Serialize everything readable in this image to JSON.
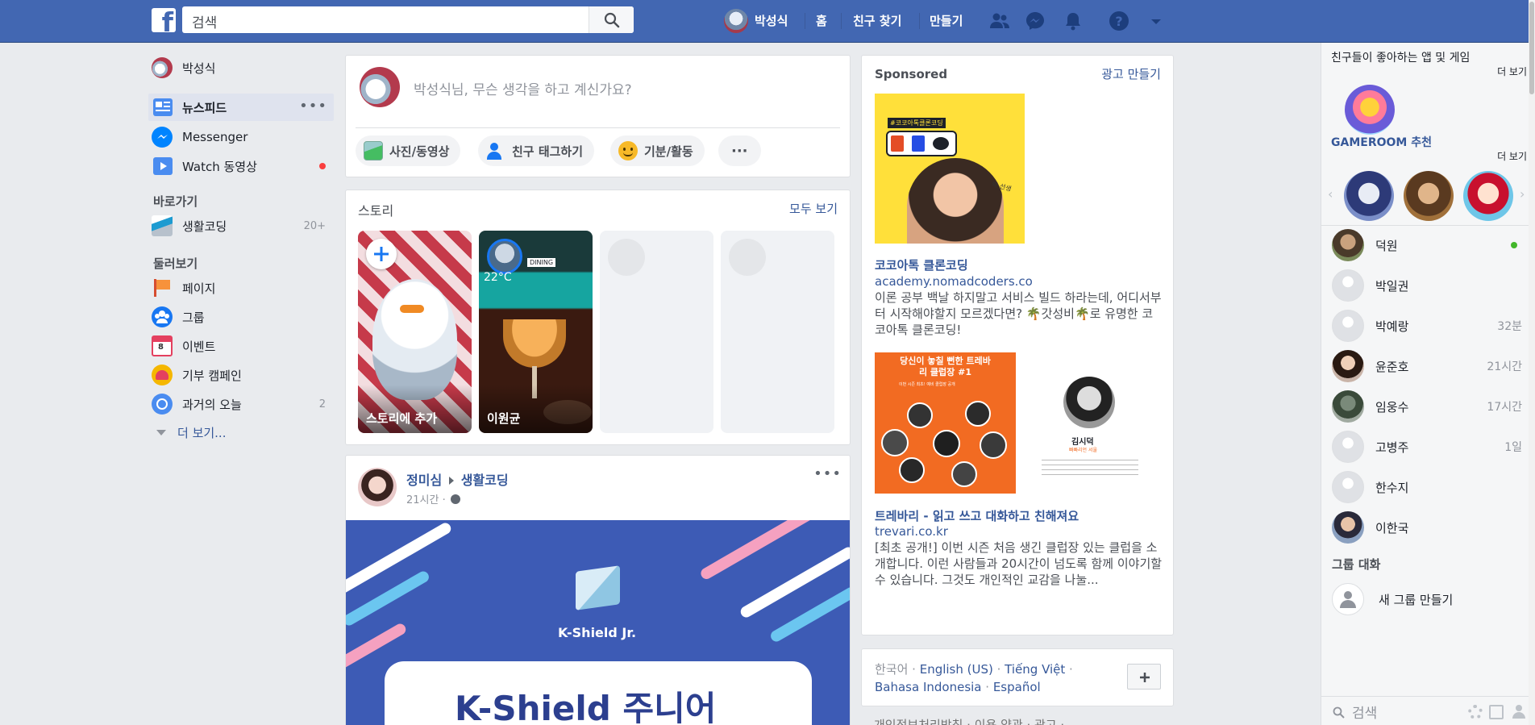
{
  "topbar": {
    "search_placeholder": "검색",
    "user_name": "박성식",
    "home": "홈",
    "find_friends": "친구 찾기",
    "create": "만들기"
  },
  "left": {
    "profile_name": "박성식",
    "items": [
      {
        "label": "뉴스피드",
        "icon": "newsfeed-icon"
      },
      {
        "label": "Messenger",
        "icon": "messenger-icon"
      },
      {
        "label": "Watch 동영상",
        "icon": "watch-icon"
      }
    ],
    "shortcuts_title": "바로가기",
    "shortcut": {
      "label": "생활코딩",
      "count": "20+"
    },
    "explore_title": "둘러보기",
    "explore": [
      {
        "label": "페이지",
        "icon": "flag-icon",
        "count": ""
      },
      {
        "label": "그룹",
        "icon": "groups-icon",
        "count": ""
      },
      {
        "label": "이벤트",
        "icon": "calendar-icon",
        "count": ""
      },
      {
        "label": "기부 캠페인",
        "icon": "heart-icon",
        "count": ""
      },
      {
        "label": "과거의 오늘",
        "icon": "clock-icon",
        "count": "2"
      }
    ],
    "see_more": "더 보기..."
  },
  "composer": {
    "placeholder": "박성식님, 무슨 생각을 하고 계신가요?",
    "photo_video": "사진/동영상",
    "tag_friends": "친구 태그하기",
    "feeling": "기분/활동",
    "more": "···"
  },
  "stories": {
    "title": "스토리",
    "see_all": "모두 보기",
    "add_story": "스토리에 추가",
    "friend_story_name": "이원균",
    "friend_story_overlay": "22°C",
    "friend_story_tag": "DINING"
  },
  "post": {
    "author": "정미심",
    "target": "생활코딩",
    "time": "21시간 ·",
    "image_brand": "K-Shield Jr.",
    "image_title": "K-Shield 주니어"
  },
  "sponsored": {
    "title": "Sponsored",
    "create_ad": "광고 만들기",
    "ad1": {
      "title": "코코아톡 클론코딩",
      "domain": "academy.nomadcoders.co",
      "text": "이론 공부 백날 하지말고 서비스 빌드 하라는데, 어디서부터 시작해야할지 모르겠다면? 🌴갓성비🌴로 유명한 코코아톡 클론코딩!",
      "image_badge": "#코코아톡클론코딩",
      "image_handwriting": "박 선생"
    },
    "ad2": {
      "title": "트레바리 - 읽고 쓰고 대화하고 친해져요",
      "domain": "trevari.co.kr",
      "text": "[최초 공개!] 이번 시즌 처음 생긴 클럽장 있는 클럽을 소개합니다. 이런 사람들과 20시간이 넘도록 함께 이야기할 수 있습니다. 그것도 개인적인 교감을 나눌...",
      "image_heading": "당신이 놓칠 뻔한 트레바리 클럽장 #1",
      "image_sub": "이번 시즌 최초! 예비 클럽장 공개",
      "person_name": "김시덕",
      "person_role": "빠빠리언 서울"
    }
  },
  "languages": {
    "items": [
      "한국어",
      "English (US)",
      "Tiếng Việt",
      "Bahasa Indonesia",
      "Español"
    ],
    "footer_partial": "개인정보처리방침 · 이용 약관 · 광고 ·"
  },
  "chat": {
    "apps_title": "친구들이 좋아하는 앱 및 게임",
    "more1": "더 보기",
    "gameroom_title": "GAMEROOM 추천",
    "more2": "더 보기",
    "contacts": [
      {
        "name": "덕원",
        "time": "",
        "online": true
      },
      {
        "name": "박일권",
        "time": "",
        "online": false
      },
      {
        "name": "박예랑",
        "time": "32분",
        "online": false
      },
      {
        "name": "윤준호",
        "time": "21시간",
        "online": false
      },
      {
        "name": "임웅수",
        "time": "17시간",
        "online": false
      },
      {
        "name": "고병주",
        "time": "1일",
        "online": false
      },
      {
        "name": "한수지",
        "time": "",
        "online": false
      },
      {
        "name": "이한국",
        "time": "",
        "online": false
      }
    ],
    "group_title": "그룹 대화",
    "new_group": "새 그룹 만들기",
    "search_placeholder": "검색"
  },
  "colors": {
    "brand": "#4267b2",
    "link": "#365899",
    "background": "#e9ebee",
    "online": "#42b72a",
    "notification_dot": "#fa3e3e"
  }
}
